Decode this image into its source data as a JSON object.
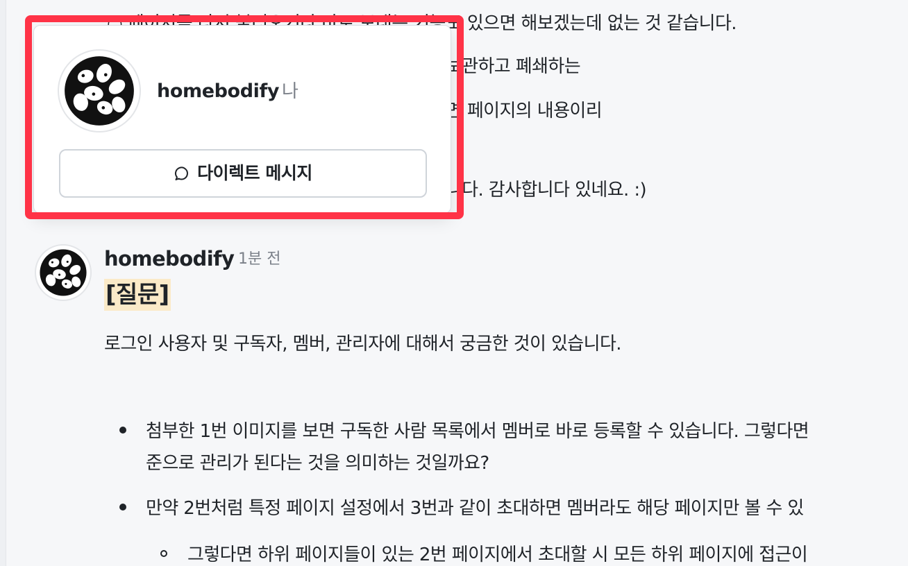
{
  "colors": {
    "accent_highlight": "#ff3347",
    "tag_background": "#fbeac8",
    "muted_text": "#7b8089"
  },
  "thread": {
    "previous_message": {
      "line1": "○ 페이지를 다시 불러오거나 바로 보내는 기능도 있으면 해보겠는데 없는 것 같습니다.",
      "line2": "○ 위 페이지를 다른 슬래시페이지로 편입시켜 보관하고 폐쇄하는",
      "line3": "○ 두 사이트간의 페이지 이동이 당장은 어렵다면 페이지의 내용이리",
      "line4": "○ 혹시 다른 방법이 있다면 알려주시면 좋겠습니다. 감사합니다 있네요. :)"
    },
    "message": {
      "author": "homebodify",
      "time": "1분 전",
      "tag": "[질문]",
      "intro": "로그인 사용자 및 구독자, 멤버, 관리자에 대해서 궁금한 것이 있습니다.",
      "bullets": [
        {
          "line1": "첨부한 1번 이미지를 보면 구독한 사람 목록에서 멤버로 바로 등록할 수 있습니다. 그렇다면",
          "line2": "준으로 관리가 된다는 것을 의미하는 것일까요?"
        },
        {
          "line1": "만약 2번처럼 특정 페이지 설정에서 3번과 같이 초대하면 멤버라도 해당 페이지만 볼 수 있"
        }
      ],
      "sub_bullets": [
        {
          "line1": "그렇다면 하위 페이지들이 있는 2번 페이지에서 초대할 시 모든 하위 페이지에 접근이"
        }
      ]
    }
  },
  "popover": {
    "name": "homebodify",
    "me_label": "나",
    "dm_button_label": "다이렉트 메시지",
    "dm_icon": "chat-bubble-icon",
    "avatar_icon": "homebodify-logo-avatar"
  }
}
